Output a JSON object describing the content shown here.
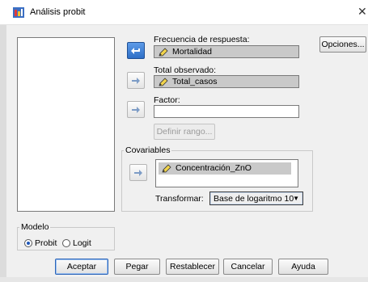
{
  "window": {
    "title": "Análisis probit"
  },
  "fields": {
    "response_freq": {
      "label": "Frecuencia de respuesta:",
      "value": "Mortalidad"
    },
    "total_observed": {
      "label": "Total observado:",
      "value": "Total_casos"
    },
    "factor": {
      "label": "Factor:",
      "value": ""
    }
  },
  "buttons": {
    "options": "Opciones...",
    "define_range": "Definir rango...",
    "ok": "Aceptar",
    "paste": "Pegar",
    "reset": "Restablecer",
    "cancel": "Cancelar",
    "help": "Ayuda"
  },
  "covariates": {
    "title": "Covariables",
    "items": [
      "Concentración_ZnO"
    ]
  },
  "transform": {
    "label": "Transformar:",
    "selected": "Base de logaritmo 10"
  },
  "model": {
    "title": "Modelo",
    "options": [
      "Probit",
      "Logit"
    ],
    "selected": "Probit"
  },
  "icons": {
    "move_arrow": "right-arrow-icon",
    "active_arrow": "left-arrow-icon",
    "variable": "pencil-icon"
  },
  "colors": {
    "active_arrow": "#2e6fc7",
    "selected_field": "#c9c9c9"
  }
}
